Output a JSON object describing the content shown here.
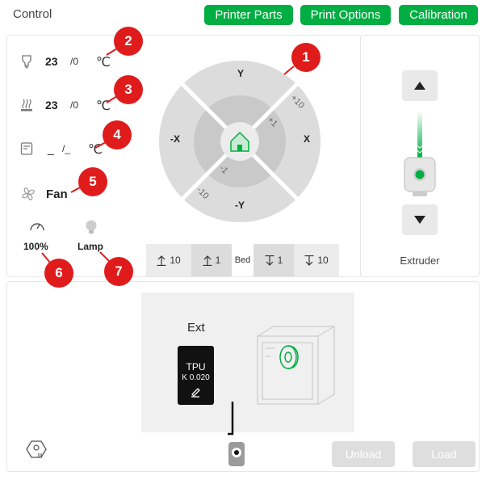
{
  "header": {
    "title": "Control",
    "buttons": {
      "printer_parts": "Printer Parts",
      "print_options": "Print Options",
      "calibration": "Calibration"
    }
  },
  "temps": {
    "nozzle": {
      "current": "23",
      "target": "/0",
      "unit": "℃",
      "icon": "nozzle-heater-icon"
    },
    "bed": {
      "current": "23",
      "target": "/0",
      "unit": "℃",
      "icon": "bed-heater-icon"
    },
    "chamber": {
      "current": "_",
      "target": "/_",
      "unit": "℃",
      "icon": "chamber-icon"
    }
  },
  "fan": {
    "label": "Fan",
    "icon": "fan-icon"
  },
  "speed": {
    "value": "100%",
    "icon": "speed-gauge-icon"
  },
  "lamp": {
    "label": "Lamp",
    "icon": "lamp-bulb-icon"
  },
  "badges": [
    "1",
    "2",
    "3",
    "4",
    "5",
    "6",
    "7"
  ],
  "jog": {
    "y_plus": "Y",
    "y_minus": "-Y",
    "x_plus": "X",
    "x_minus": "-X",
    "plus10": "+10",
    "plus1": "+1",
    "minus1": "-1",
    "minus10": "-10",
    "home_icon": "home-icon"
  },
  "bed_controls": {
    "up10": "10",
    "up1": "1",
    "label": "Bed",
    "down1": "1",
    "down10": "10"
  },
  "extruder": {
    "label": "Extruder"
  },
  "ams": {
    "ext_label": "Ext",
    "filament": {
      "type": "TPU",
      "k_value": "K 0.020",
      "color": "#111111"
    },
    "accent": "#00ae42",
    "unload": "Unload",
    "load": "Load"
  }
}
